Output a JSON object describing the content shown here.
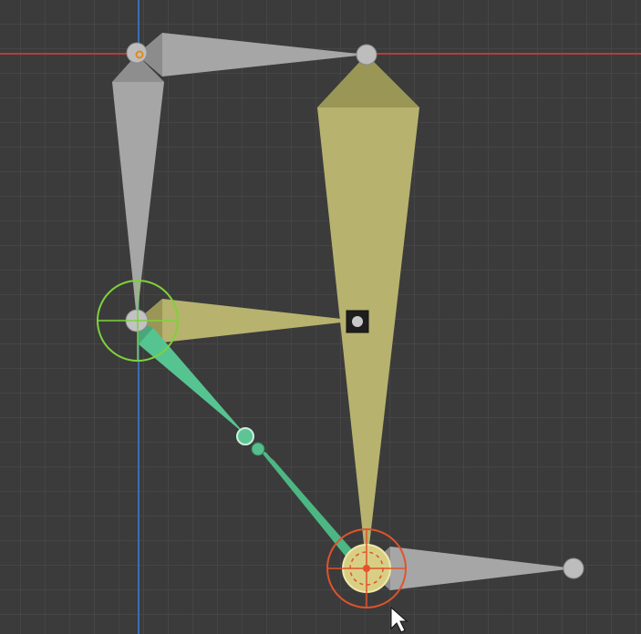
{
  "viewport": {
    "grid_color": "#464646",
    "background_color": "#3b3b3b",
    "x_axis_color": "#b43c3c",
    "y_axis_color": "#3c6eb4"
  },
  "armature": {
    "bones": [
      {
        "name": "bone-top-horizontal",
        "color": "#a8a8a8",
        "selected": false
      },
      {
        "name": "bone-left-vertical",
        "color": "#a8a8a8",
        "selected": false
      },
      {
        "name": "bone-right-vertical",
        "color": "#b8b370",
        "selected": true
      },
      {
        "name": "bone-middle-horizontal",
        "color": "#b8b370",
        "selected": true
      },
      {
        "name": "bone-lower-diagonal-1",
        "color": "#4fc08a",
        "selected": true
      },
      {
        "name": "bone-lower-diagonal-2",
        "color": "#4fc08a",
        "selected": true
      },
      {
        "name": "bone-bottom-horizontal",
        "color": "#a8a8a8",
        "selected": false
      }
    ],
    "ik_target_color": "#7fd13b",
    "pole_target_color": "#e0532c"
  },
  "icons": {
    "cursor": "mouse-pointer-icon",
    "ik-target": "ik-target-circle-icon",
    "3d-cursor": "3d-cursor-icon"
  }
}
